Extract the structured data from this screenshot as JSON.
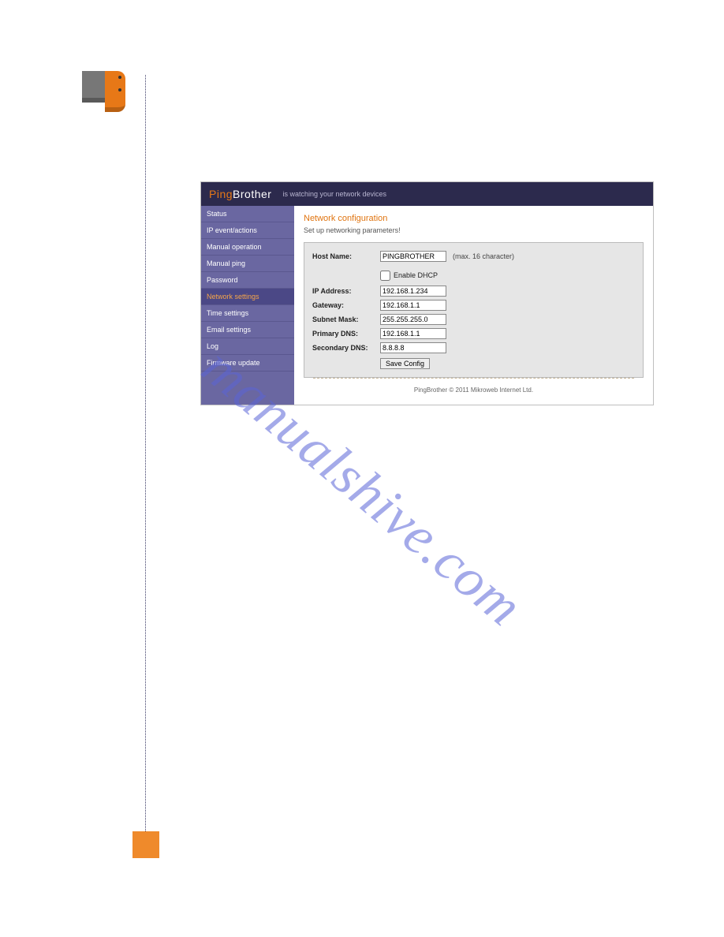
{
  "header": {
    "brand_ping": "Ping",
    "brand_brother": "Brother",
    "tagline": "is watching your network devices"
  },
  "sidenav": {
    "items": [
      {
        "label": "Status",
        "active": false
      },
      {
        "label": "IP event/actions",
        "active": false
      },
      {
        "label": "Manual operation",
        "active": false
      },
      {
        "label": "Manual ping",
        "active": false
      },
      {
        "label": "Password",
        "active": false
      },
      {
        "label": "Network settings",
        "active": true
      },
      {
        "label": "Time settings",
        "active": false
      },
      {
        "label": "Email settings",
        "active": false
      },
      {
        "label": "Log",
        "active": false
      },
      {
        "label": "Firmware update",
        "active": false
      }
    ]
  },
  "content": {
    "title": "Network configuration",
    "subtitle": "Set up networking parameters!",
    "hostname_label": "Host Name:",
    "hostname_value": "PINGBROTHER",
    "hostname_note": "(max. 16 character)",
    "dhcp_label": "Enable DHCP",
    "rows": [
      {
        "label": "IP Address:",
        "value": "192.168.1.234"
      },
      {
        "label": "Gateway:",
        "value": "192.168.1.1"
      },
      {
        "label": "Subnet Mask:",
        "value": "255.255.255.0"
      },
      {
        "label": "Primary DNS:",
        "value": "192.168.1.1"
      },
      {
        "label": "Secondary DNS:",
        "value": "8.8.8.8"
      }
    ],
    "save_label": "Save Config"
  },
  "footer": "PingBrother © 2011 Mikroweb Internet Ltd.",
  "watermark": "manualshive.com"
}
